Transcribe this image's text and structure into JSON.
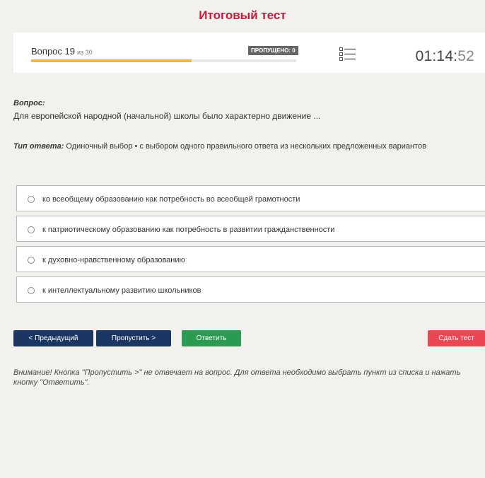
{
  "header": {
    "title": "Итоговый тест"
  },
  "progress": {
    "question_label": "Вопрос 19",
    "of_label": "из 30",
    "skipped_label": "ПРОПУЩЕНО: 0",
    "fill_fraction": 0.604
  },
  "timer": {
    "main": "01:14:",
    "seconds": "52"
  },
  "question": {
    "caption": "Вопрос:",
    "text": "Для европейской народной (начальной) школы было характерно движение ..."
  },
  "answer_type": {
    "caption": "Тип ответа:",
    "value": "Одиночный выбор • с выбором одного правильного ответа из нескольких предложенных вариантов"
  },
  "options": [
    "ко всеобщему образованию как потребность во всеобщей грамотности",
    "к патриотическому образованию как потребность в развитии гражданственности",
    "к духовно-нравственному образованию",
    "к интеллектуальному развитию школьников"
  ],
  "buttons": {
    "prev": "< Предыдущий",
    "skip": "Пропустить >",
    "answer": "Ответить",
    "finish": "Сдать тест"
  },
  "notice": "Внимание! Кнопка \"Пропустить >\" не отвечает на вопрос. Для ответа необходимо выбрать пункт из списка и нажать кнопку \"Ответить\".",
  "colors": {
    "title": "#c8193c",
    "progress": "#f0b44c",
    "primary": "#1c3664",
    "success": "#2b9a52",
    "danger": "#ec4553"
  }
}
